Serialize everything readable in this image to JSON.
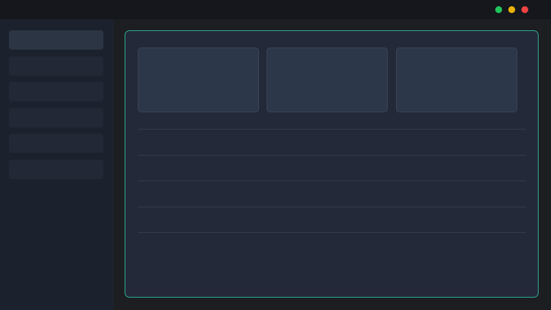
{
  "window": {
    "controls": [
      {
        "name": "maximize",
        "color": "#22c55e"
      },
      {
        "name": "minimize",
        "color": "#eab308"
      },
      {
        "name": "close",
        "color": "#ef4444"
      }
    ]
  },
  "sidebar": {
    "items": [
      {
        "label": "",
        "active": true
      },
      {
        "label": "",
        "active": false
      },
      {
        "label": "",
        "active": false
      },
      {
        "label": "",
        "active": false
      },
      {
        "label": "",
        "active": false
      },
      {
        "label": "",
        "active": false
      }
    ]
  },
  "main": {
    "accent_color": "#2fb59a",
    "cards": [
      {
        "label": ""
      },
      {
        "label": ""
      },
      {
        "label": ""
      }
    ],
    "rows": [
      {
        "text": ""
      },
      {
        "text": ""
      },
      {
        "text": ""
      },
      {
        "text": ""
      }
    ]
  }
}
